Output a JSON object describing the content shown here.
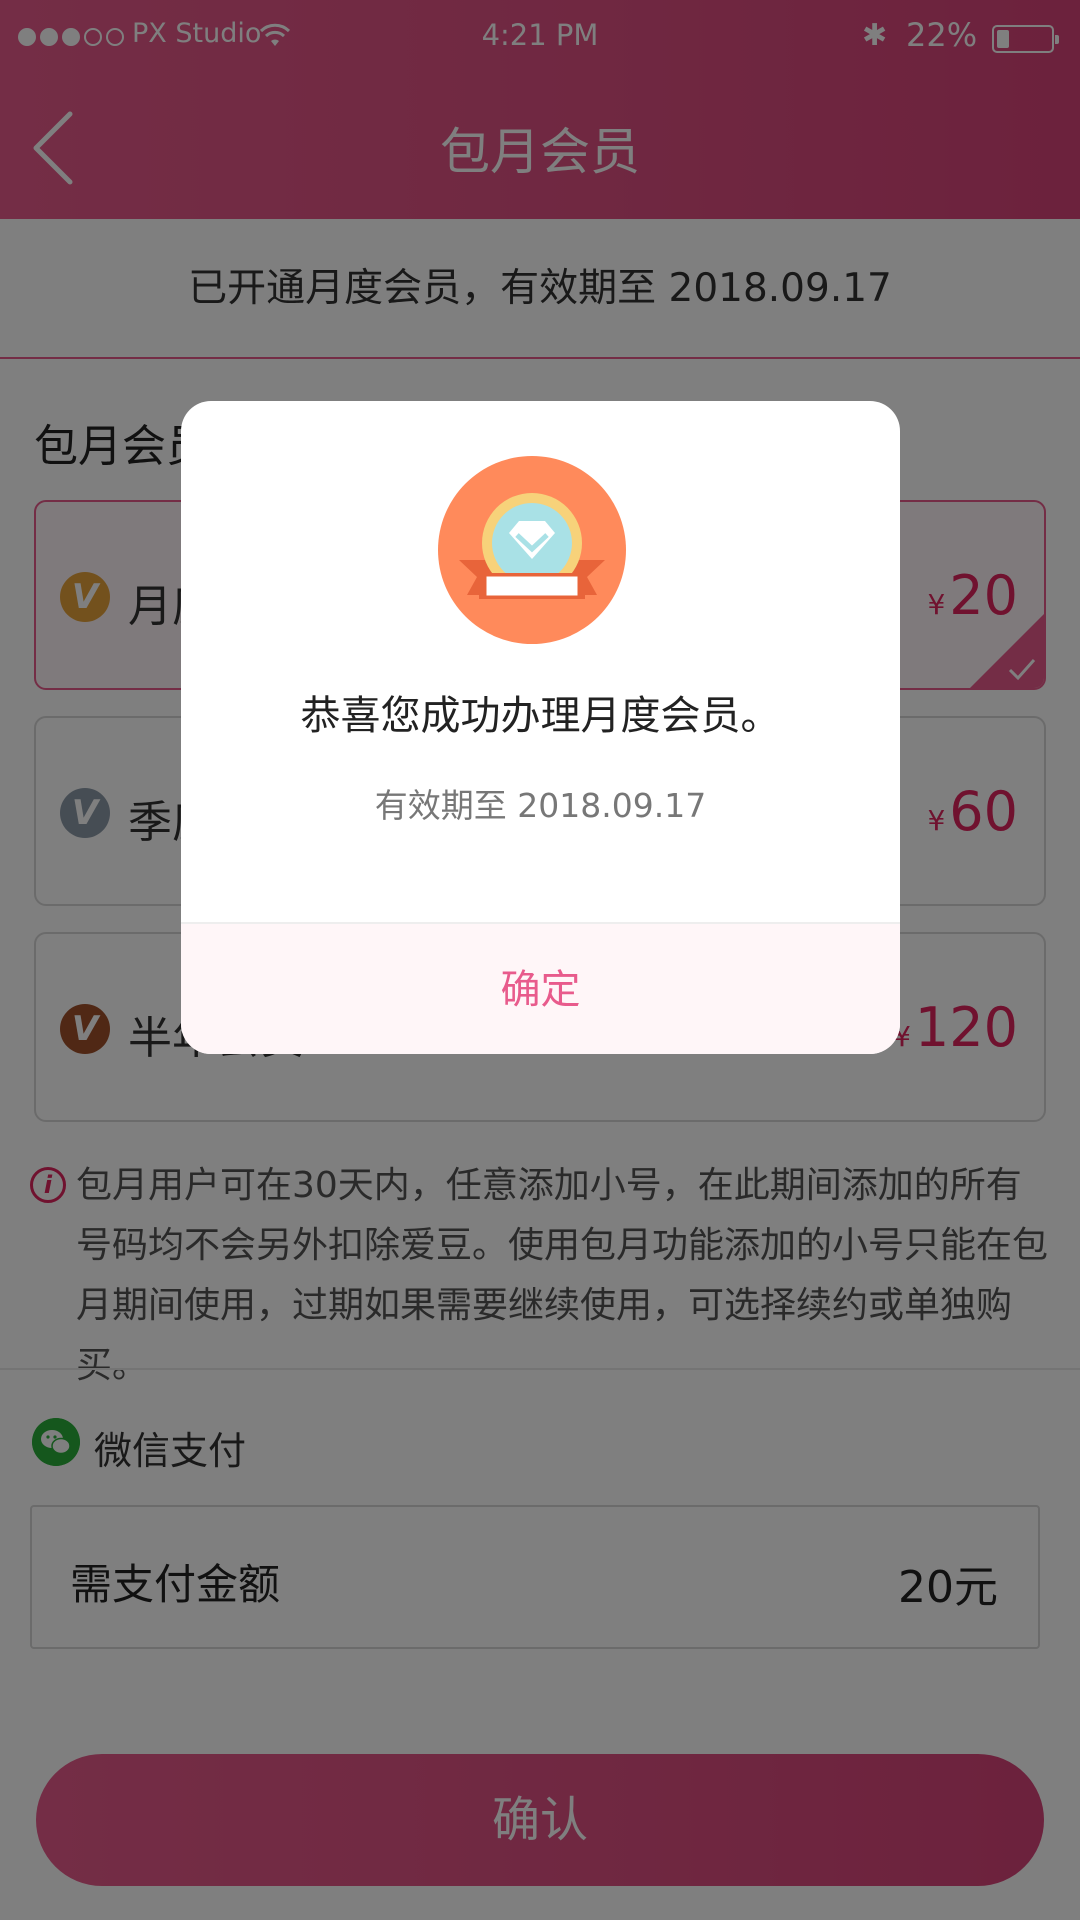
{
  "status_bar": {
    "carrier": "PX Studio",
    "time": "4:21 PM",
    "battery_percent": "22%",
    "battery_level": 0.22
  },
  "header": {
    "title": "包月会员"
  },
  "notice": {
    "text": "已开通月度会员，有效期至 2018.09.17"
  },
  "plans": {
    "heading": "包月会员",
    "items": [
      {
        "name": "月度会员",
        "badge_letter": "V",
        "badge_color": "#e7a33b",
        "currency": "¥",
        "price": "20",
        "selected": true
      },
      {
        "name": "季度会员",
        "badge_letter": "V",
        "badge_color": "#8d9aa8",
        "currency": "¥",
        "price": "60",
        "selected": false
      },
      {
        "name": "半年会员",
        "badge_letter": "V",
        "badge_color": "#a0502b",
        "currency": "¥",
        "price": "120",
        "selected": false
      }
    ]
  },
  "info": {
    "icon": "i",
    "text": "包月用户可在30天内，任意添加小号，在此期间添加的所有号码均不会另外扣除爱豆。使用包月功能添加的小号只能在包月期间使用，过期如果需要继续使用，可选择续约或单独购买。"
  },
  "payment": {
    "method_label": "微信支付",
    "amount_label": "需支付金额",
    "amount_value": "20元"
  },
  "confirm_button": {
    "label": "确认"
  },
  "dialog": {
    "title": "恭喜您成功办理月度会员。",
    "subtitle": "有效期至 2018.09.17",
    "ok_label": "确定"
  },
  "colors": {
    "accent": "#e85b8c",
    "price": "#e0245e",
    "overlay": "rgba(0,0,0,0.5)",
    "medal_bg": "#ff8a5b"
  }
}
